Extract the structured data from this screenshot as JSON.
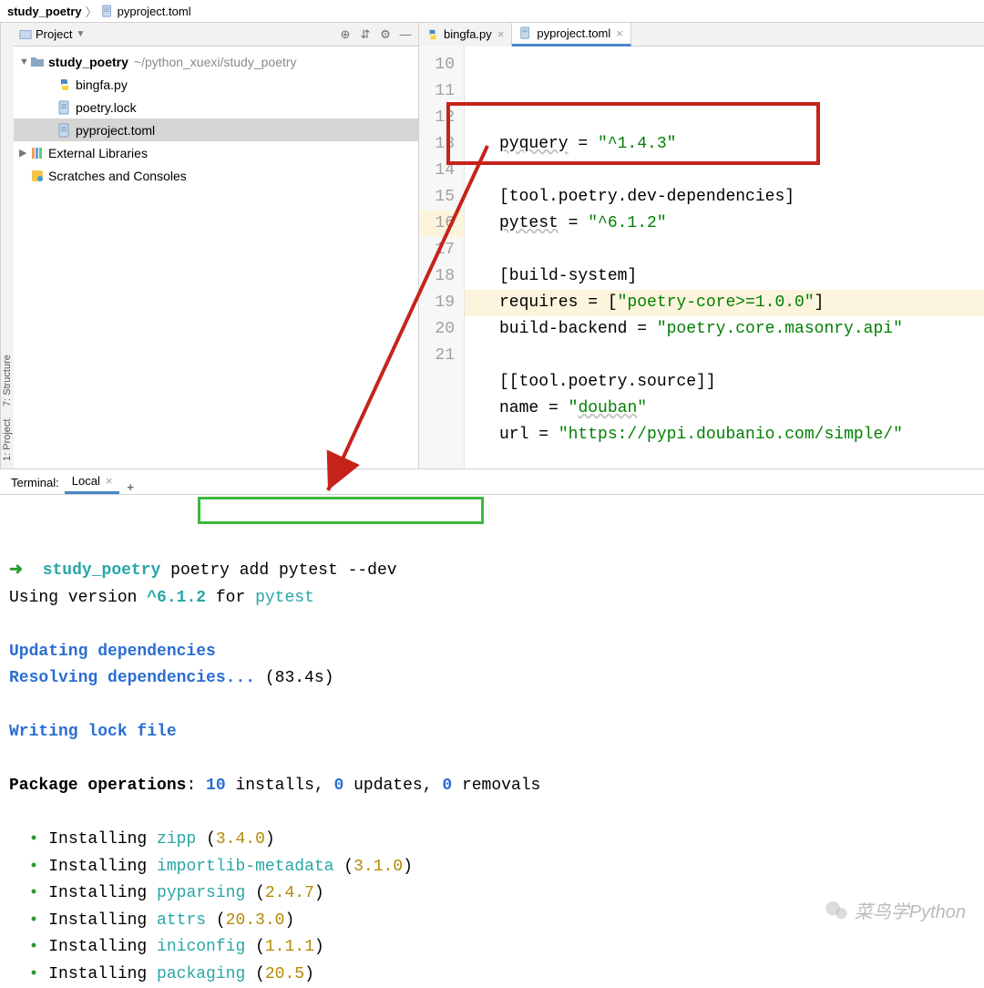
{
  "breadcrumb": {
    "root": "study_poetry",
    "file": "pyproject.toml"
  },
  "project_header": {
    "title": "Project",
    "icons": {
      "target": "⊕",
      "collapse": "⇵",
      "settings": "⚙",
      "hide": "—"
    }
  },
  "tree": {
    "root_name": "study_poetry",
    "root_path": "~/python_xuexi/study_poetry",
    "items": [
      {
        "name": "bingfa.py",
        "kind": "py",
        "selected": false
      },
      {
        "name": "poetry.lock",
        "kind": "file",
        "selected": false
      },
      {
        "name": "pyproject.toml",
        "kind": "file",
        "selected": true
      }
    ],
    "external": "External Libraries",
    "scratches": "Scratches and Consoles"
  },
  "tabs": [
    {
      "label": "bingfa.py",
      "kind": "py",
      "active": false
    },
    {
      "label": "pyproject.toml",
      "kind": "file",
      "active": true
    }
  ],
  "editor": {
    "first_line_no": 10,
    "lines": [
      {
        "text": "pyquery = \"^1.4.3\"",
        "hl": false,
        "squiggle_word": "pyquery"
      },
      {
        "text": "",
        "hl": false
      },
      {
        "text": "[tool.poetry.dev-dependencies]",
        "hl": false,
        "redbox": true
      },
      {
        "text": "pytest = \"^6.1.2\"",
        "hl": false,
        "redbox": true,
        "squiggle_word": "pytest"
      },
      {
        "text": "",
        "hl": false
      },
      {
        "text": "[build-system]",
        "hl": false
      },
      {
        "text": "requires = [\"poetry-core>=1.0.0\"]",
        "hl": true
      },
      {
        "text": "build-backend = \"poetry.core.masonry.api\"",
        "hl": false
      },
      {
        "text": "",
        "hl": false
      },
      {
        "text": "[[tool.poetry.source]]",
        "hl": false
      },
      {
        "text": "name = \"douban\"",
        "hl": false,
        "squiggle_word": "douban"
      },
      {
        "text": "url = \"https://pypi.doubanio.com/simple/\"",
        "hl": false
      }
    ]
  },
  "terminal_header": {
    "label": "Terminal:",
    "tab": "Local"
  },
  "terminal": {
    "prompt_arrow": "➜",
    "prompt_dir": "study_poetry",
    "command": "poetry add pytest --dev",
    "lines": [
      {
        "parts": [
          {
            "t": "Using version ",
            "c": ""
          },
          {
            "t": "^6.1.2",
            "c": "term-cyan bold"
          },
          {
            "t": " for ",
            "c": ""
          },
          {
            "t": "pytest",
            "c": "term-cyan"
          }
        ]
      },
      {
        "parts": []
      },
      {
        "parts": [
          {
            "t": "Updating dependencies",
            "c": "term-blue"
          }
        ]
      },
      {
        "parts": [
          {
            "t": "Resolving dependencies...",
            "c": "term-blue"
          },
          {
            "t": " (83.4s)",
            "c": ""
          }
        ]
      },
      {
        "parts": []
      },
      {
        "parts": [
          {
            "t": "Writing lock file",
            "c": "term-blue"
          }
        ]
      },
      {
        "parts": []
      },
      {
        "parts": [
          {
            "t": "Package operations",
            "c": "bold"
          },
          {
            "t": ": ",
            "c": ""
          },
          {
            "t": "10",
            "c": "term-blue"
          },
          {
            "t": " installs, ",
            "c": ""
          },
          {
            "t": "0",
            "c": "term-blue"
          },
          {
            "t": " updates, ",
            "c": ""
          },
          {
            "t": "0",
            "c": "term-blue"
          },
          {
            "t": " removals",
            "c": ""
          }
        ]
      },
      {
        "parts": []
      },
      {
        "parts": [
          {
            "t": "  • ",
            "c": "term-green"
          },
          {
            "t": "Installing ",
            "c": ""
          },
          {
            "t": "zipp",
            "c": "term-cyan"
          },
          {
            "t": " (",
            "c": ""
          },
          {
            "t": "3.4.0",
            "c": "term-gold"
          },
          {
            "t": ")",
            "c": ""
          }
        ]
      },
      {
        "parts": [
          {
            "t": "  • ",
            "c": "term-green"
          },
          {
            "t": "Installing ",
            "c": ""
          },
          {
            "t": "importlib-metadata",
            "c": "term-cyan"
          },
          {
            "t": " (",
            "c": ""
          },
          {
            "t": "3.1.0",
            "c": "term-gold"
          },
          {
            "t": ")",
            "c": ""
          }
        ]
      },
      {
        "parts": [
          {
            "t": "  • ",
            "c": "term-green"
          },
          {
            "t": "Installing ",
            "c": ""
          },
          {
            "t": "pyparsing",
            "c": "term-cyan"
          },
          {
            "t": " (",
            "c": ""
          },
          {
            "t": "2.4.7",
            "c": "term-gold"
          },
          {
            "t": ")",
            "c": ""
          }
        ]
      },
      {
        "parts": [
          {
            "t": "  • ",
            "c": "term-green"
          },
          {
            "t": "Installing ",
            "c": ""
          },
          {
            "t": "attrs",
            "c": "term-cyan"
          },
          {
            "t": " (",
            "c": ""
          },
          {
            "t": "20.3.0",
            "c": "term-gold"
          },
          {
            "t": ")",
            "c": ""
          }
        ]
      },
      {
        "parts": [
          {
            "t": "  • ",
            "c": "term-green"
          },
          {
            "t": "Installing ",
            "c": ""
          },
          {
            "t": "iniconfig",
            "c": "term-cyan"
          },
          {
            "t": " (",
            "c": ""
          },
          {
            "t": "1.1.1",
            "c": "term-gold"
          },
          {
            "t": ")",
            "c": ""
          }
        ]
      },
      {
        "parts": [
          {
            "t": "  • ",
            "c": "term-green"
          },
          {
            "t": "Installing ",
            "c": ""
          },
          {
            "t": "packaging",
            "c": "term-cyan"
          },
          {
            "t": " (",
            "c": ""
          },
          {
            "t": "20.5",
            "c": "term-gold"
          },
          {
            "t": ")",
            "c": ""
          }
        ]
      }
    ]
  },
  "watermark": "菜鸟学Python",
  "left_rail": {
    "project": "1: Project",
    "structure": "7: Structure"
  }
}
